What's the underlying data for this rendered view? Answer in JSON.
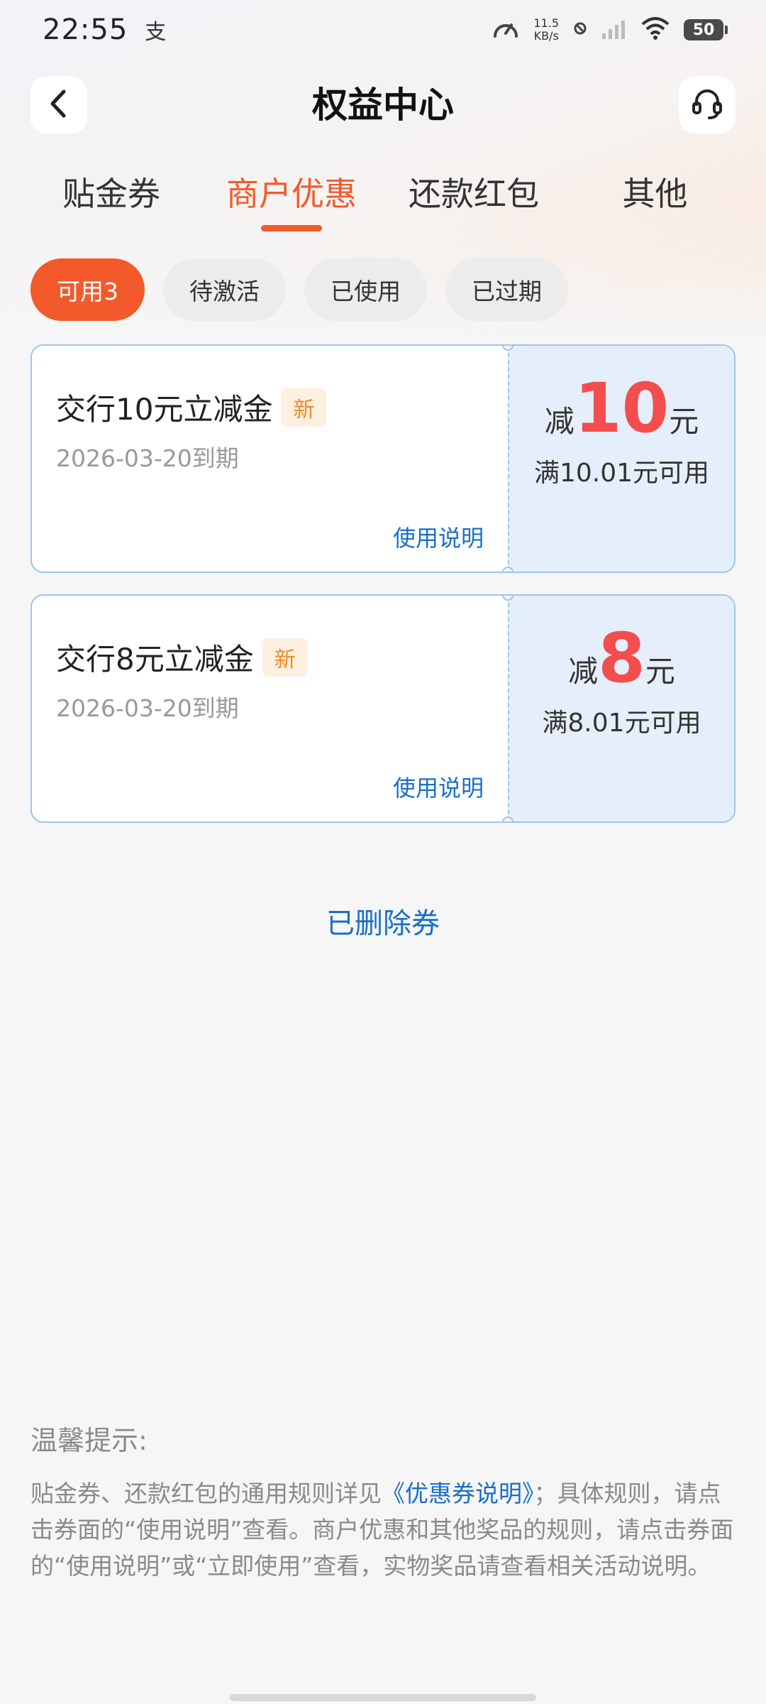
{
  "status_bar": {
    "time": "22:55",
    "alipay_glyph": "支",
    "speed_value": "11.5",
    "speed_unit": "KB/s",
    "battery": "50"
  },
  "header": {
    "title": "权益中心",
    "back_icon": "chevron-left-icon",
    "service_icon": "headset-icon"
  },
  "tabs": [
    {
      "label": "贴金券"
    },
    {
      "label": "商户优惠",
      "active": true
    },
    {
      "label": "还款红包"
    },
    {
      "label": "其他"
    }
  ],
  "filters": [
    {
      "label": "可用3",
      "active": true
    },
    {
      "label": "待激活"
    },
    {
      "label": "已使用"
    },
    {
      "label": "已过期"
    }
  ],
  "coupons": [
    {
      "title": "交行10元立减金",
      "badge": "新",
      "expiry": "2026-03-20到期",
      "help": "使用说明",
      "prefix": "减",
      "amount": "10",
      "unit": "元",
      "condition": "满10.01元可用"
    },
    {
      "title": "交行8元立减金",
      "badge": "新",
      "expiry": "2026-03-20到期",
      "help": "使用说明",
      "prefix": "减",
      "amount": "8",
      "unit": "元",
      "condition": "满8.01元可用"
    }
  ],
  "deleted_link": "已删除券",
  "tips": {
    "title": "温馨提示:",
    "body_part1": "贴金券、还款红包的通用规则详见",
    "link": "《优惠券说明》",
    "body_part2": "；具体规则，请点击券面的“使用说明”查看。商户优惠和其他奖品的规则，请点击券面的“使用说明”或“立即使用”查看，实物奖品请查看相关活动说明。"
  },
  "colors": {
    "accent": "#f25a2c",
    "link": "#1a6fc6",
    "amount": "#f24e4e",
    "coupon_border": "#9ec5e8",
    "coupon_right_bg": "#e5eefb",
    "badge_text": "#ee8a25"
  }
}
